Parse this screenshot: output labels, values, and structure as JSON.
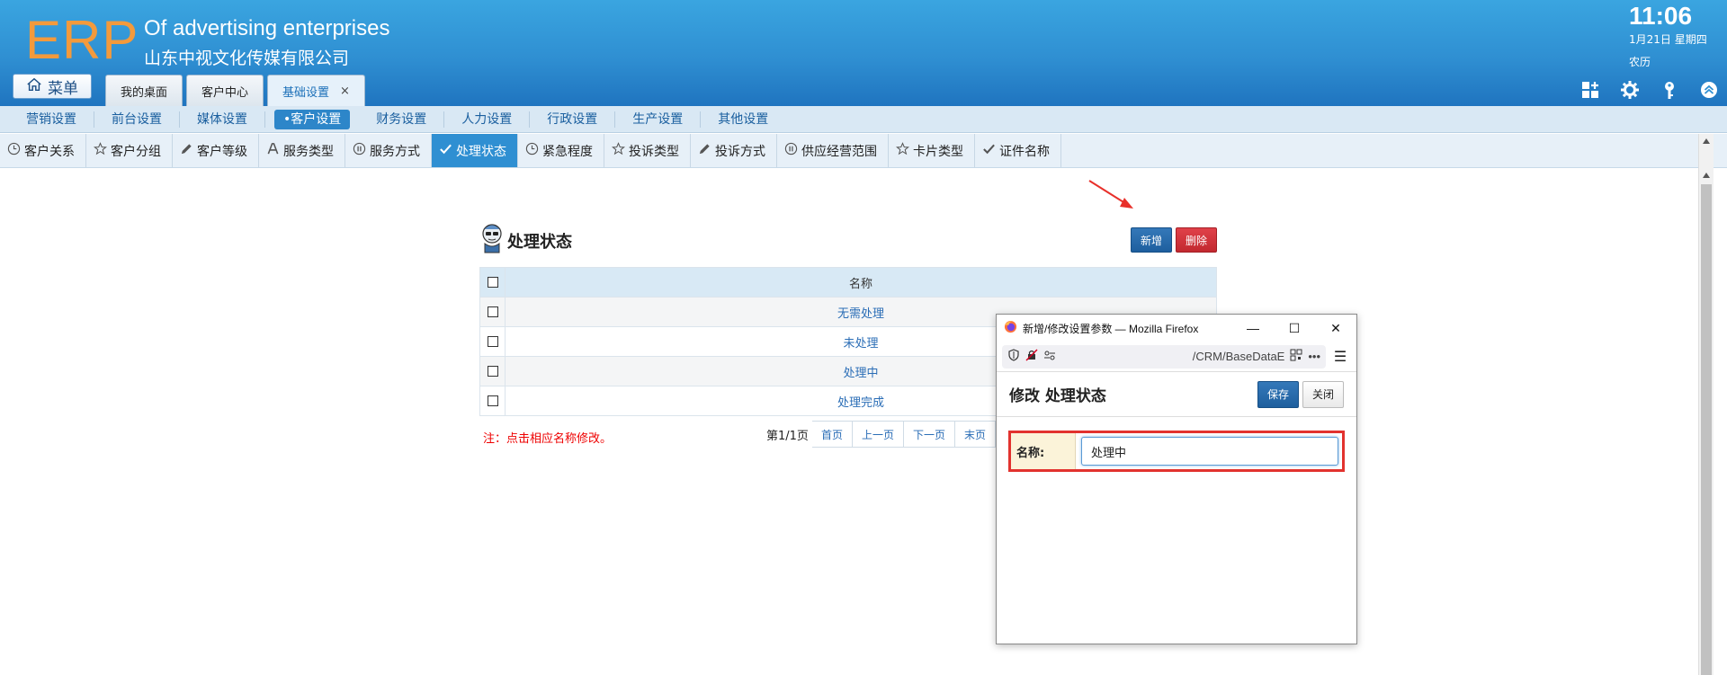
{
  "header": {
    "logo": "ERP",
    "company_en": "Of advertising enterprises",
    "company_cn": "山东中视文化传媒有限公司",
    "menu_label": "菜单",
    "tabs": [
      {
        "label": "我的桌面",
        "active": false
      },
      {
        "label": "客户中心",
        "active": false
      },
      {
        "label": "基础设置",
        "active": true,
        "close": "×"
      }
    ],
    "time": "11:06",
    "date": "1月21日 星期四",
    "lunar": "农历",
    "icons": [
      "grid-add-icon",
      "gear-icon",
      "key-icon",
      "collapse-up-icon"
    ]
  },
  "nav1": {
    "items": [
      "营销设置",
      "前台设置",
      "媒体设置",
      "客户设置",
      "财务设置",
      "人力设置",
      "行政设置",
      "生产设置",
      "其他设置"
    ],
    "active_index": 3
  },
  "nav2": {
    "items": [
      {
        "label": "客户关系",
        "icon": "clock-icon"
      },
      {
        "label": "客户分组",
        "icon": "star-icon"
      },
      {
        "label": "客户等级",
        "icon": "pencil-icon"
      },
      {
        "label": "服务类型",
        "icon": "font-a-icon"
      },
      {
        "label": "服务方式",
        "icon": "pause-circle-icon"
      },
      {
        "label": "处理状态",
        "icon": "check-icon"
      },
      {
        "label": "紧急程度",
        "icon": "clock-icon"
      },
      {
        "label": "投诉类型",
        "icon": "star-icon"
      },
      {
        "label": "投诉方式",
        "icon": "pencil-icon"
      },
      {
        "label": "供应经营范围",
        "icon": "pause-circle-icon"
      },
      {
        "label": "卡片类型",
        "icon": "star-icon"
      },
      {
        "label": "证件名称",
        "icon": "check-icon"
      }
    ],
    "active_index": 5
  },
  "panel": {
    "title": "处理状态",
    "add_label": "新增",
    "delete_label": "删除",
    "column_header": "名称",
    "rows": [
      "无需处理",
      "未处理",
      "处理中",
      "处理完成"
    ],
    "note": "注：点击相应名称修改。",
    "pager": {
      "info": "第1/1页",
      "first": "首页",
      "prev": "上一页",
      "next": "下一页",
      "last": "末页"
    }
  },
  "popup": {
    "window_title": "新增/修改设置参数 — Mozilla Firefox",
    "url": "/CRM/BaseDataE",
    "minimize": "—",
    "maximize": "☐",
    "close": "✕",
    "url_more": "•••",
    "menu": "☰",
    "heading": "修改 处理状态",
    "save_label": "保存",
    "close_label": "关闭",
    "field_label": "名称:",
    "field_value": "处理中"
  },
  "colors": {
    "header_blue": "#2f8fd2",
    "logo_orange": "#f39a3c",
    "active_tab": "#2f8fd2",
    "delete_red": "#c22930",
    "highlight_red": "#e2322e",
    "link_blue": "#2a6db6"
  }
}
